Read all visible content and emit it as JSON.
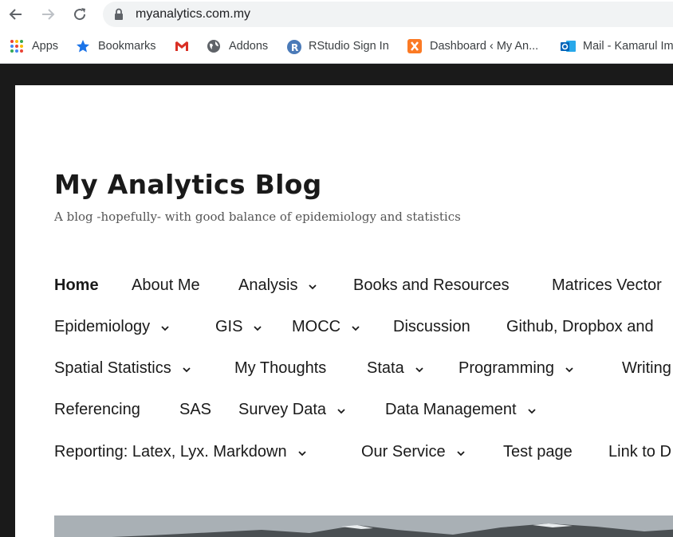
{
  "browser": {
    "url": "myanalytics.com.my",
    "bookmarks": [
      {
        "label": "Apps",
        "icon": "apps-grid-icon"
      },
      {
        "label": "Bookmarks",
        "icon": "star-icon"
      },
      {
        "label": "",
        "icon": "gmail-icon"
      },
      {
        "label": "Addons",
        "icon": "globe-icon"
      },
      {
        "label": "RStudio Sign In",
        "icon": "rstudio-icon"
      },
      {
        "label": "Dashboard ‹ My An...",
        "icon": "xampp-icon"
      },
      {
        "label": "Mail - Kamarul Im",
        "icon": "outlook-icon"
      }
    ]
  },
  "site": {
    "title": "My Analytics Blog",
    "description": "A blog -hopefully- with good balance of epidemiology and statistics",
    "menu": {
      "row1": [
        "Home",
        "About Me",
        "Analysis",
        "Books and Resources",
        "Matrices Vector"
      ],
      "row2": [
        "Epidemiology",
        "GIS",
        "MOCC",
        "Discussion",
        "Github, Dropbox and"
      ],
      "row3": [
        "Spatial Statistics",
        "My Thoughts",
        "Stata",
        "Programming",
        "Writing"
      ],
      "row4": [
        "Referencing",
        "SAS",
        "Survey Data",
        "Data Management"
      ],
      "row5": [
        "Reporting: Latex, Lyx. Markdown",
        "Our Service",
        "Test page",
        "Link to D"
      ]
    }
  },
  "colors": {
    "page_bg": "#1a1a1a",
    "content_bg": "#ffffff",
    "text": "#1a1a1a",
    "description": "#555555",
    "omnibox": "#f1f3f4"
  }
}
